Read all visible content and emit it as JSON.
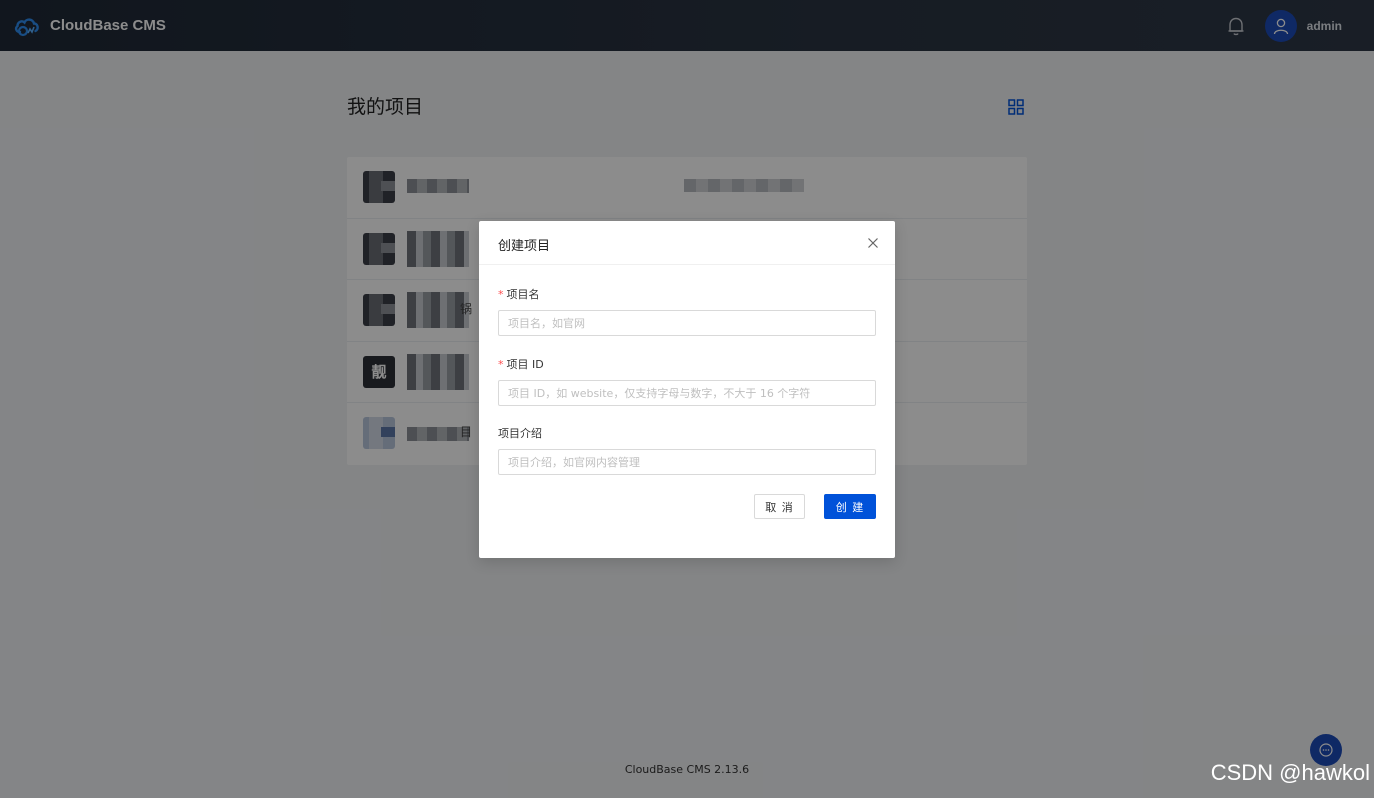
{
  "header": {
    "brand": "CloudBase CMS",
    "username": "admin"
  },
  "main": {
    "title": "我的项目",
    "projects": [
      {
        "name_tail": ""
      },
      {
        "name_tail": ""
      },
      {
        "name_tail": "锅"
      },
      {
        "thumb_char": "靓",
        "name_tail": ""
      },
      {
        "name_tail": "目"
      }
    ]
  },
  "footer": {
    "version": "CloudBase CMS 2.13.6",
    "watermark": "CSDN @hawkol"
  },
  "modal": {
    "title": "创建项目",
    "fields": {
      "name": {
        "label": "项目名",
        "placeholder": "项目名，如官网",
        "value": ""
      },
      "id": {
        "label": "项目 ID",
        "placeholder": "项目 ID，如 website，仅支持字母与数字，不大于 16 个字符",
        "value": ""
      },
      "desc": {
        "label": "项目介绍",
        "placeholder": "项目介绍，如官网内容管理",
        "value": ""
      }
    },
    "cancel_label": "取 消",
    "ok_label": "创 建",
    "required_mark": "*"
  },
  "colors": {
    "primary": "#0052d9",
    "header_bg": "#1f2937",
    "required": "#ff4d4f"
  }
}
